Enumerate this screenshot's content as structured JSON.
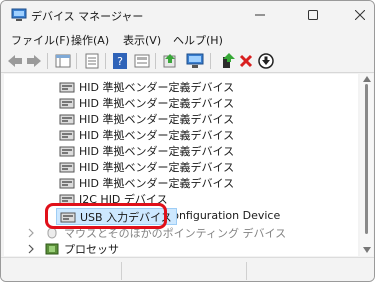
{
  "window": {
    "title": "デバイス マネージャー"
  },
  "menu": [
    "ファイル(F)",
    "操作(A)",
    "表示(V)",
    "ヘルプ(H)"
  ],
  "toolbar": {
    "buttons": [
      "back-icon",
      "forward-icon",
      "show-hide-icon",
      "properties-icon",
      "help-icon",
      "details-icon",
      "update-driver-icon",
      "scan-hardware-icon",
      "enable-device-icon",
      "uninstall-icon",
      "download-icon"
    ]
  },
  "tree": {
    "hid_items": [
      "HID 準拠ベンダー定義デバイス",
      "HID 準拠ベンダー定義デバイス",
      "HID 準拠ベンダー定義デバイス",
      "HID 準拠ベンダー定義デバイス",
      "HID 準拠ベンダー定義デバイス",
      "HID 準拠ベンダー定義デバイス",
      "HID 準拠ベンダー定義デバイス"
    ],
    "i2c": "I2C HID デバイス",
    "config_device_partial": "Microsoft Input Configuration Device",
    "selected": "USB 入力デバイス",
    "category_partial": "マウスとそのほかのポインティング デバイス",
    "processor": "プロセッサ"
  },
  "colors": {
    "highlight_border": "#e0101a",
    "selection_bg": "#cde8ff",
    "accent": "#0067c0"
  }
}
